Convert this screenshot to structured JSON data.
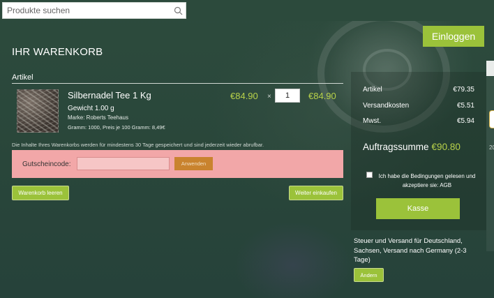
{
  "search": {
    "placeholder": "Produkte suchen"
  },
  "header": {
    "login_label": "Einloggen"
  },
  "page": {
    "title": "IHR WARENKORB"
  },
  "cart": {
    "column_label": "Artikel",
    "items": [
      {
        "name": "Silbernadel Tee 1 Kg",
        "weight": "Gewicht 1.00 g",
        "brand": "Marke: Roberts Teehaus",
        "grams": "Gramm: 1000, Preis je 100 Gramm: 8,49€",
        "unit_price": "€84.90",
        "times": "×",
        "quantity": "1",
        "total": "€84.90"
      }
    ],
    "save_note": "Die Inhalte Ihres Warenkorbs werden für mindestens 30 Tage gespeichert und sind jederzeit wieder abrufbar.",
    "coupon_label": "Gutscheincode:",
    "coupon_apply": "Anwenden",
    "clear_label": "Warenkorb leeren",
    "continue_label": "Weiter einkaufen"
  },
  "summary": {
    "rows": [
      {
        "label": "Artikel",
        "value": "€79.35"
      },
      {
        "label": "Versandkosten",
        "value": "€5.51"
      },
      {
        "label": "Mwst.",
        "value": "€5.94"
      }
    ],
    "total_label": "Auftragssumme",
    "total_value": "€90.80",
    "agb_text": "Ich habe die Bedingungen gelesen und akzeptiere sie: AGB",
    "checkout_label": "Kasse",
    "shipping_text": "Steuer und Versand für Deutschland, Sachsen, Versand nach Germany (2-3 Tage)",
    "change_label": "Ändern"
  },
  "edge": {
    "number": "20"
  },
  "icons": {
    "search": "search-icon"
  },
  "colors": {
    "accent": "#9bc23a",
    "price": "#b9d34a",
    "coupon_bg": "#f2a7a8",
    "apply": "#c9832e"
  }
}
